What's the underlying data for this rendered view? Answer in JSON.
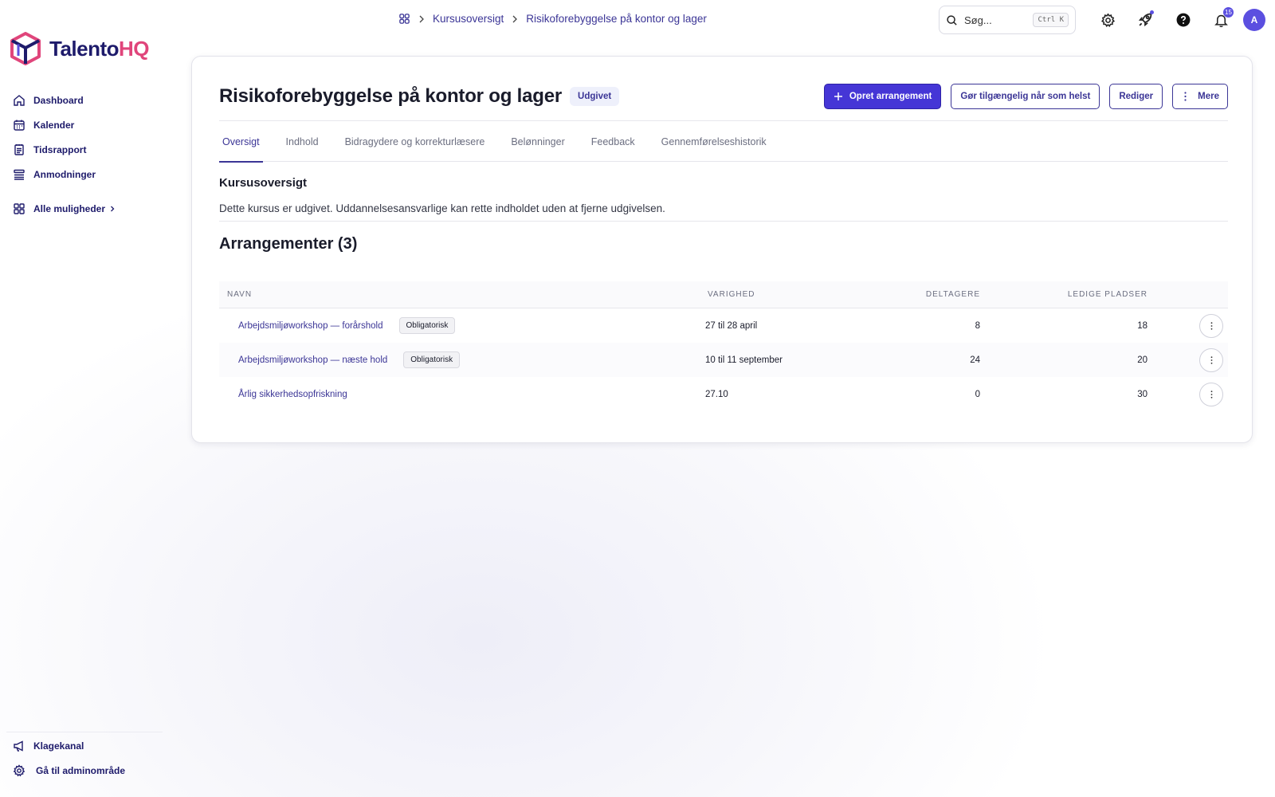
{
  "brand": {
    "name_main": "Talento",
    "name_accent": "HQ",
    "primary_color": "#4536d6",
    "accent_color": "#e0457b"
  },
  "sidebar": {
    "items": [
      {
        "label": "Dashboard",
        "icon": "home-icon"
      },
      {
        "label": "Kalender",
        "icon": "calendar-icon"
      },
      {
        "label": "Tidsrapport",
        "icon": "timesheet-icon"
      },
      {
        "label": "Anmodninger",
        "icon": "list-icon"
      }
    ],
    "all_options": "Alle muligheder",
    "bottom": [
      {
        "label": "Klagekanal",
        "icon": "megaphone-icon"
      },
      {
        "label": "Gå til adminområde",
        "icon": "gear-icon"
      }
    ]
  },
  "topbar": {
    "breadcrumb": [
      "Kursusoversigt",
      "Risikoforebyggelse på kontor og lager"
    ],
    "search_placeholder": "Søg...",
    "search_shortcut": "Ctrl K",
    "notification_count": "15",
    "avatar_initial": "A"
  },
  "course": {
    "title": "Risikoforebyggelse på kontor og lager",
    "status": "Udgivet",
    "actions": {
      "create_event": "Opret arrangement",
      "make_available": "Gør tilgængelig når som helst",
      "edit": "Rediger",
      "more": "Mere"
    },
    "tabs": [
      "Oversigt",
      "Indhold",
      "Bidragydere og korrekturlæsere",
      "Belønninger",
      "Feedback",
      "Gennemførelseshistorik"
    ],
    "overview_title": "Kursusoversigt",
    "overview_text": "Dette kursus er udgivet. Uddannelsesansvarlige kan rette indholdet uden at fjerne udgivelsen."
  },
  "events": {
    "title": "Arrangementer (3)",
    "columns": [
      "Navn",
      "Varighed",
      "Deltagere",
      "Ledige pladser"
    ],
    "rows": [
      {
        "name": "Arbejdsmiljøworkshop — forårshold",
        "tag": "Obligatorisk",
        "duration": "27 til 28 april",
        "participants": "8",
        "free": "18"
      },
      {
        "name": "Arbejdsmiljøworkshop — næste hold",
        "tag": "Obligatorisk",
        "duration": "10 til 11 september",
        "participants": "24",
        "free": "20"
      },
      {
        "name": "Årlig sikkerhedsopfriskning",
        "tag": "",
        "duration": "27.10",
        "participants": "0",
        "free": "30"
      }
    ]
  }
}
